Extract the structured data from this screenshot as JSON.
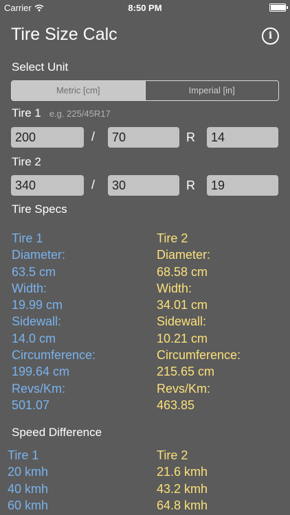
{
  "status_bar": {
    "carrier": "Carrier",
    "time": "8:50 PM",
    "battery_level": 1.0
  },
  "header": {
    "title": "Tire Size Calc",
    "info_icon": "info-icon"
  },
  "unit_select": {
    "label": "Select Unit",
    "options": [
      "Metric [cm]",
      "Imperial [in]"
    ],
    "selected": "Metric [cm]"
  },
  "tire1": {
    "label": "Tire 1",
    "hint": "e.g. 225/45R17",
    "width": "200",
    "ratio": "70",
    "rim": "14",
    "slash": "/",
    "r": "R"
  },
  "tire2": {
    "label": "Tire 2",
    "width": "340",
    "ratio": "30",
    "rim": "19",
    "slash": "/",
    "r": "R"
  },
  "specs": {
    "label": "Tire Specs",
    "tire1": [
      "Tire 1",
      "Diameter:",
      "63.5 cm",
      "Width:",
      "19.99 cm",
      "Sidewall:",
      "14.0 cm",
      "Circumference:",
      "199.64 cm",
      "Revs/Km:",
      "501.07"
    ],
    "tire2": [
      "Tire 2",
      "Diameter:",
      "68.58 cm",
      "Width:",
      "34.01 cm",
      "Sidewall:",
      "10.21 cm",
      "Circumference:",
      "215.65 cm",
      "Revs/Km:",
      "463.85"
    ]
  },
  "speed": {
    "label": "Speed Difference",
    "tire1": [
      "Tire 1",
      "20 kmh",
      "40 kmh",
      "60 kmh"
    ],
    "tire2": [
      "Tire 2",
      "21.6 kmh",
      "43.2 kmh",
      "64.8 kmh"
    ]
  },
  "colors": {
    "background": "#5b5b5b",
    "tire1": "#7ab3ee",
    "tire2": "#fbe07a"
  }
}
